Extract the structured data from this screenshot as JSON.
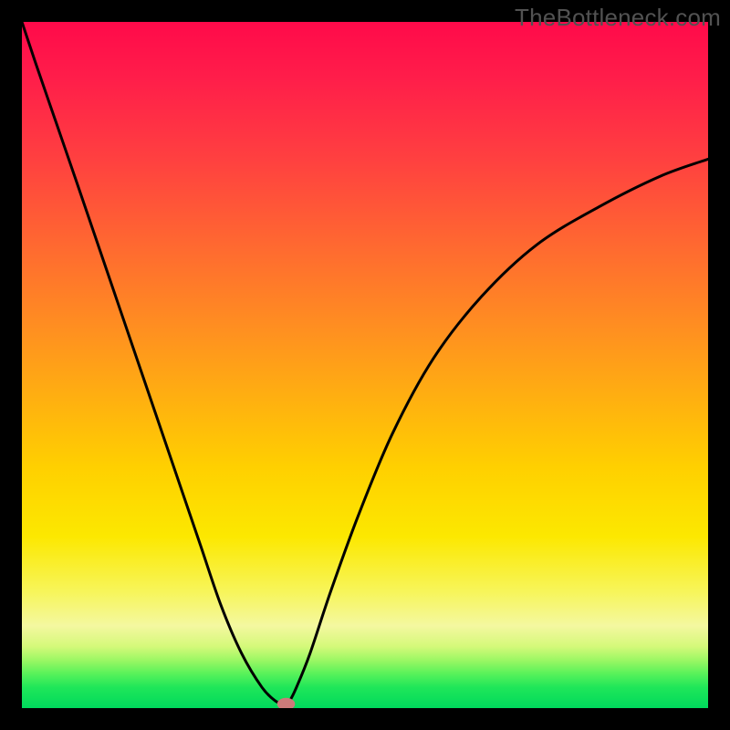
{
  "watermark": "TheBottleneck.com",
  "chart_data": {
    "type": "line",
    "title": "",
    "xlabel": "",
    "ylabel": "",
    "xlim": [
      0,
      100
    ],
    "ylim": [
      0,
      100
    ],
    "grid": false,
    "legend": false,
    "line_color": "#000000",
    "line_width": 3,
    "x": [
      0,
      2,
      5,
      8,
      11,
      14,
      17,
      20,
      23,
      26,
      29,
      32,
      35,
      37,
      38,
      38.5,
      39,
      40,
      42,
      45,
      49,
      54,
      60,
      67,
      75,
      84,
      93,
      100
    ],
    "y": [
      100,
      94,
      85.3,
      76.6,
      67.8,
      59,
      50.2,
      41.4,
      32.6,
      23.8,
      15,
      8,
      3,
      1,
      0.7,
      0.6,
      1,
      3,
      8,
      17,
      28,
      40,
      51,
      60,
      67.5,
      73,
      77.5,
      80
    ],
    "marker": {
      "shape": "ellipse",
      "x": 38.5,
      "y": 0.6,
      "rx": 1.3,
      "ry": 0.9,
      "fill": "#cc7b7a"
    },
    "gradient_stops": [
      {
        "pct": 0,
        "color": "#ff0a4a"
      },
      {
        "pct": 8,
        "color": "#ff1d4a"
      },
      {
        "pct": 20,
        "color": "#ff4040"
      },
      {
        "pct": 33,
        "color": "#ff6a30"
      },
      {
        "pct": 45,
        "color": "#ff9020"
      },
      {
        "pct": 55,
        "color": "#ffb010"
      },
      {
        "pct": 65,
        "color": "#ffd000"
      },
      {
        "pct": 75,
        "color": "#fce800"
      },
      {
        "pct": 83,
        "color": "#f7f55a"
      },
      {
        "pct": 88,
        "color": "#f4f8a0"
      },
      {
        "pct": 91,
        "color": "#d5f97a"
      },
      {
        "pct": 93,
        "color": "#9cf764"
      },
      {
        "pct": 95,
        "color": "#58f25a"
      },
      {
        "pct": 97,
        "color": "#1fe659"
      },
      {
        "pct": 100,
        "color": "#00d95c"
      }
    ]
  }
}
